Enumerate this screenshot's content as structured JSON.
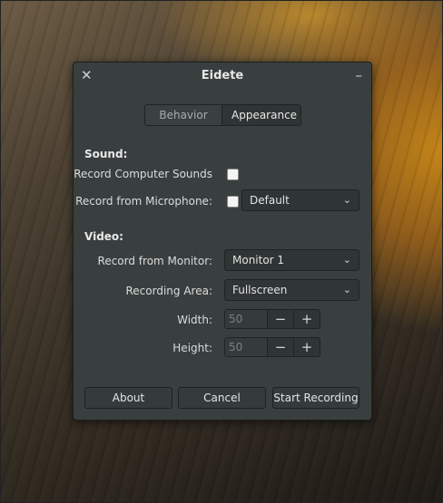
{
  "window": {
    "title": "Eidete"
  },
  "tabs": [
    "Behavior",
    "Appearance"
  ],
  "sound": {
    "heading": "Sound:",
    "computer_sounds_label": "Record Computer Sounds",
    "microphone_label": "Record from Microphone:",
    "microphone_device": "Default"
  },
  "video": {
    "heading": "Video:",
    "monitor_label": "Record from Monitor:",
    "monitor_value": "Monitor 1",
    "area_label": "Recording Area:",
    "area_value": "Fullscreen",
    "width_label": "Width:",
    "width_value": "50",
    "height_label": "Height:",
    "height_value": "50"
  },
  "buttons": {
    "about": "About",
    "cancel": "Cancel",
    "start": "Start Recording"
  }
}
